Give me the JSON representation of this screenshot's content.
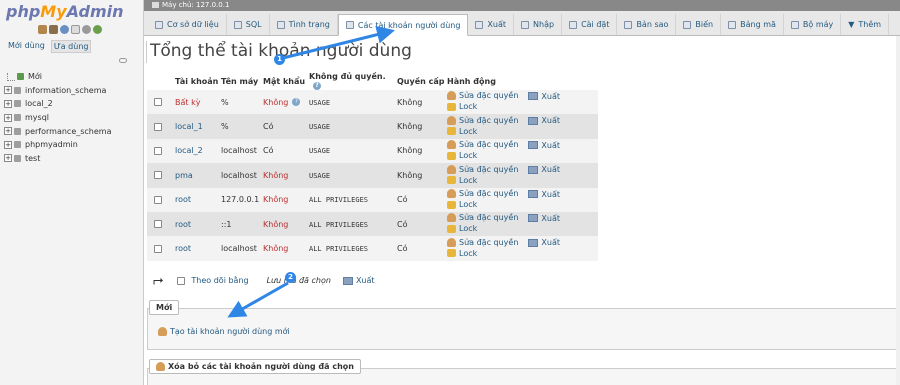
{
  "app": {
    "logo_php": "php",
    "logo_my": "My",
    "logo_admin": "Admin"
  },
  "nav": {
    "tab_recent": "Mới dùng",
    "tab_favorites": "Ưa dùng",
    "tree": [
      {
        "label": "Mới",
        "type": "new"
      },
      {
        "label": "information_schema",
        "type": "db"
      },
      {
        "label": "local_2",
        "type": "db"
      },
      {
        "label": "mysql",
        "type": "db"
      },
      {
        "label": "performance_schema",
        "type": "db"
      },
      {
        "label": "phpmyadmin",
        "type": "db"
      },
      {
        "label": "test",
        "type": "db"
      }
    ]
  },
  "topbar": {
    "label": "Máy chủ: 127.0.0.1"
  },
  "tabs": [
    {
      "label": "Cơ sở dữ liệu",
      "active": false
    },
    {
      "label": "SQL",
      "active": false
    },
    {
      "label": "Tình trạng",
      "active": false
    },
    {
      "label": "Các tài khoản người dùng",
      "active": true
    },
    {
      "label": "Xuất",
      "active": false
    },
    {
      "label": "Nhập",
      "active": false
    },
    {
      "label": "Cài đặt",
      "active": false
    },
    {
      "label": "Bản sao",
      "active": false
    },
    {
      "label": "Biến",
      "active": false
    },
    {
      "label": "Bảng mã",
      "active": false
    },
    {
      "label": "Bộ máy",
      "active": false
    },
    {
      "label": "Thêm",
      "active": false
    }
  ],
  "main": {
    "heading": "Tổng thể tài khoản người dùng",
    "table": {
      "headers": [
        "Tài khoản",
        "Tên máy",
        "Mật khẩu",
        "Không đủ quyền.",
        "Quyền cấp",
        "Hành động"
      ],
      "rows": [
        {
          "account": "Bất kỳ",
          "host": "%",
          "password": "Không",
          "privs": "USAGE",
          "grant": "Không"
        },
        {
          "account": "local_1",
          "host": "%",
          "password": "Có",
          "privs": "USAGE",
          "grant": "Không"
        },
        {
          "account": "local_2",
          "host": "localhost",
          "password": "Có",
          "privs": "USAGE",
          "grant": "Không"
        },
        {
          "account": "pma",
          "host": "localhost",
          "password": "Không",
          "privs": "USAGE",
          "grant": "Không"
        },
        {
          "account": "root",
          "host": "127.0.0.1",
          "password": "Không",
          "privs": "ALL PRIVILEGES",
          "grant": "Có"
        },
        {
          "account": "root",
          "host": "::1",
          "password": "Không",
          "privs": "ALL PRIVILEGES",
          "grant": "Có"
        },
        {
          "account": "root",
          "host": "localhost",
          "password": "Không",
          "privs": "ALL PRIVILEGES",
          "grant": "Có"
        }
      ],
      "action_edit": "Sửa đặc quyền",
      "action_export": "Xuất",
      "action_lock": "Lock"
    },
    "bulk": {
      "check_all": "Theo dõi bằng",
      "with_selected": "Lưu mà đã chọn",
      "export": "Xuất"
    },
    "new_section": {
      "legend": "Mới",
      "add_user": "Tạo tài khoản người dùng mới"
    },
    "delete_section": {
      "legend": "Xóa bỏ các tài khoản người dùng đã chọn"
    },
    "annotations": [
      "1",
      "2"
    ]
  }
}
